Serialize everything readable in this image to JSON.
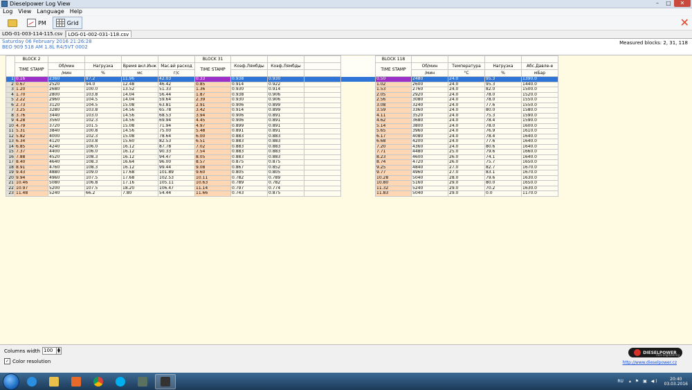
{
  "window": {
    "title": "Dieselpower Log View"
  },
  "menu": [
    "Log",
    "View",
    "Language",
    "Help"
  ],
  "toolbar": {
    "pm_label": "PM",
    "grid_label": "Grid"
  },
  "file_tabs": [
    "LOG-01-003-114-115.csv",
    "LOG-01-002-031-118.csv"
  ],
  "info": {
    "date": "Saturday 06 February 2016 21:26:28",
    "vehicle": "BEO 909 518 AM   1.8L R4/5VT       0002",
    "measured_blocks": "Measured blocks: 2, 31, 118"
  },
  "grid": {
    "block_labels": [
      "BLOCK 2",
      "BLOCK 31",
      "BLOCK 118"
    ],
    "time_stamp_label": "TIME STAMP",
    "b2_headers": [
      {
        "name": "Об/мин",
        "unit": "/мин"
      },
      {
        "name": "Нагрузка",
        "unit": "%"
      },
      {
        "name": "Время вкл.Инж",
        "unit": "мс"
      },
      {
        "name": "Мас.вй расход",
        "unit": "г/с"
      }
    ],
    "b31_headers": [
      {
        "name": "Коэф.Лямбды",
        "unit": ""
      },
      {
        "name": "Коэф.Лямбды",
        "unit": ""
      }
    ],
    "b118_headers": [
      {
        "name": "Об/мин",
        "unit": "/мин"
      },
      {
        "name": "Температура",
        "unit": "°C"
      },
      {
        "name": "Нагрузка",
        "unit": "%"
      },
      {
        "name": "Абс.Давле-е",
        "unit": "мБар"
      }
    ],
    "rows": [
      {
        "n": "1",
        "t2": "0.16",
        "b2": [
          "2360",
          "87.2",
          "11.96",
          "42.03"
        ],
        "t31": "0.33",
        "b31": [
          "0.938",
          "0.930"
        ],
        "t118": "0.50",
        "b118": [
          "2480",
          "24.0",
          "95.3",
          "1390.0"
        ]
      },
      {
        "n": "2",
        "t2": "0.67",
        "b2": [
          "2520",
          "94.0",
          "12.48",
          "46.42"
        ],
        "t31": "0.85",
        "b31": [
          "0.914",
          "0.922"
        ],
        "t118": "1.02",
        "b118": [
          "2600",
          "24.0",
          "95.3",
          "1440.0"
        ]
      },
      {
        "n": "3",
        "t2": "1.20",
        "b2": [
          "2680",
          "100.0",
          "13.52",
          "51.33"
        ],
        "t31": "1.36",
        "b31": [
          "0.930",
          "0.914"
        ],
        "t118": "1.53",
        "b118": [
          "2760",
          "24.0",
          "82.0",
          "1500.0"
        ]
      },
      {
        "n": "4",
        "t2": "1.70",
        "b2": [
          "2800",
          "103.8",
          "14.04",
          "56.44"
        ],
        "t31": "1.87",
        "b31": [
          "0.938",
          "0.906"
        ],
        "t118": "2.05",
        "b118": [
          "2920",
          "24.0",
          "78.0",
          "1520.0"
        ]
      },
      {
        "n": "5",
        "t2": "2.22",
        "b2": [
          "2960",
          "104.5",
          "14.04",
          "59.64"
        ],
        "t31": "2.39",
        "b31": [
          "0.930",
          "0.906"
        ],
        "t118": "2.56",
        "b118": [
          "3080",
          "24.0",
          "78.0",
          "1550.0"
        ]
      },
      {
        "n": "6",
        "t2": "2.73",
        "b2": [
          "3120",
          "104.5",
          "15.08",
          "63.81"
        ],
        "t31": "2.91",
        "b31": [
          "0.906",
          "0.899"
        ],
        "t118": "3.08",
        "b118": [
          "3240",
          "24.0",
          "77.6",
          "1550.0"
        ]
      },
      {
        "n": "7",
        "t2": "3.25",
        "b2": [
          "3280",
          "103.8",
          "14.56",
          "65.78"
        ],
        "t31": "3.42",
        "b31": [
          "0.914",
          "0.899"
        ],
        "t118": "3.59",
        "b118": [
          "3360",
          "24.0",
          "80.0",
          "1580.0"
        ]
      },
      {
        "n": "8",
        "t2": "3.76",
        "b2": [
          "3440",
          "103.0",
          "14.56",
          "68.53"
        ],
        "t31": "3.94",
        "b31": [
          "0.906",
          "0.891"
        ],
        "t118": "4.11",
        "b118": [
          "3520",
          "24.0",
          "75.3",
          "1590.0"
        ]
      },
      {
        "n": "9",
        "t2": "4.28",
        "b2": [
          "3560",
          "102.3",
          "14.56",
          "69.94"
        ],
        "t31": "4.45",
        "b31": [
          "0.906",
          "0.891"
        ],
        "t118": "4.62",
        "b118": [
          "3680",
          "24.0",
          "78.4",
          "1590.0"
        ]
      },
      {
        "n": "10",
        "t2": "4.79",
        "b2": [
          "3720",
          "101.5",
          "15.08",
          "71.94"
        ],
        "t31": "4.97",
        "b31": [
          "0.899",
          "0.891"
        ],
        "t118": "5.14",
        "b118": [
          "3800",
          "24.0",
          "78.0",
          "1600.0"
        ]
      },
      {
        "n": "11",
        "t2": "5.31",
        "b2": [
          "3840",
          "100.8",
          "14.56",
          "75.00"
        ],
        "t31": "5.48",
        "b31": [
          "0.891",
          "0.891"
        ],
        "t118": "5.65",
        "b118": [
          "3960",
          "24.0",
          "76.9",
          "1610.0"
        ]
      },
      {
        "n": "12",
        "t2": "5.82",
        "b2": [
          "4000",
          "102.3",
          "15.08",
          "78.64"
        ],
        "t31": "6.00",
        "b31": [
          "0.883",
          "0.883"
        ],
        "t118": "6.17",
        "b118": [
          "4080",
          "24.0",
          "78.4",
          "1640.0"
        ]
      },
      {
        "n": "13",
        "t2": "6.34",
        "b2": [
          "4120",
          "103.8",
          "15.60",
          "82.53"
        ],
        "t31": "6.51",
        "b31": [
          "0.883",
          "0.883"
        ],
        "t118": "6.68",
        "b118": [
          "4200",
          "24.0",
          "77.6",
          "1640.0"
        ]
      },
      {
        "n": "14",
        "t2": "6.85",
        "b2": [
          "4240",
          "106.0",
          "16.12",
          "87.78"
        ],
        "t31": "7.02",
        "b31": [
          "0.883",
          "0.883"
        ],
        "t118": "7.20",
        "b118": [
          "4360",
          "24.0",
          "80.6",
          "1640.0"
        ]
      },
      {
        "n": "15",
        "t2": "7.37",
        "b2": [
          "4400",
          "106.0",
          "16.12",
          "90.33"
        ],
        "t31": "7.54",
        "b31": [
          "0.883",
          "0.883"
        ],
        "t118": "7.71",
        "b118": [
          "4480",
          "25.0",
          "79.6",
          "1660.0"
        ]
      },
      {
        "n": "16",
        "t2": "7.88",
        "b2": [
          "4520",
          "108.3",
          "16.12",
          "94.47"
        ],
        "t31": "8.05",
        "b31": [
          "0.883",
          "0.883"
        ],
        "t118": "8.23",
        "b118": [
          "4600",
          "26.0",
          "74.1",
          "1640.0"
        ]
      },
      {
        "n": "17",
        "t2": "8.40",
        "b2": [
          "4640",
          "108.3",
          "16.64",
          "96.00"
        ],
        "t31": "8.57",
        "b31": [
          "0.875",
          "0.875"
        ],
        "t118": "8.74",
        "b118": [
          "4720",
          "26.0",
          "75.7",
          "1650.0"
        ]
      },
      {
        "n": "18",
        "t2": "8.91",
        "b2": [
          "4760",
          "108.3",
          "16.12",
          "99.44"
        ],
        "t31": "9.08",
        "b31": [
          "0.867",
          "0.852"
        ],
        "t118": "9.25",
        "b118": [
          "4840",
          "27.0",
          "82.7",
          "1670.0"
        ]
      },
      {
        "n": "19",
        "t2": "9.43",
        "b2": [
          "4880",
          "109.0",
          "17.68",
          "101.89"
        ],
        "t31": "9.60",
        "b31": [
          "0.805",
          "0.805"
        ],
        "t118": "9.77",
        "b118": [
          "4960",
          "27.0",
          "83.1",
          "1670.0"
        ]
      },
      {
        "n": "20",
        "t2": "9.94",
        "b2": [
          "4960",
          "107.5",
          "17.68",
          "102.53"
        ],
        "t31": "10.11",
        "b31": [
          "0.782",
          "0.789"
        ],
        "t118": "10.28",
        "b118": [
          "5040",
          "28.0",
          "79.6",
          "1630.0"
        ]
      },
      {
        "n": "21",
        "t2": "10.46",
        "b2": [
          "5080",
          "106.8",
          "17.16",
          "105.11"
        ],
        "t31": "10.63",
        "b31": [
          "0.789",
          "0.782"
        ],
        "t118": "10.80",
        "b118": [
          "5160",
          "29.0",
          "80.0",
          "1650.0"
        ]
      },
      {
        "n": "22",
        "t2": "10.97",
        "b2": [
          "5200",
          "107.5",
          "18.20",
          "106.47"
        ],
        "t31": "11.14",
        "b31": [
          "0.797",
          "0.774"
        ],
        "t118": "11.32",
        "b118": [
          "5240",
          "29.0",
          "70.2",
          "1630.0"
        ]
      },
      {
        "n": "23",
        "t2": "11.48",
        "b2": [
          "5240",
          "66.2",
          "7.80",
          "54.44"
        ],
        "t31": "11.66",
        "b31": [
          "0.743",
          "0.875"
        ],
        "t118": "11.83",
        "b118": [
          "5040",
          "29.0",
          "0.0",
          "1170.0"
        ]
      }
    ]
  },
  "bottom": {
    "columns_width_label": "Columns width",
    "columns_width_value": "100",
    "color_resolution_label": "Color resolution",
    "logo_text": "DIESELPOWER",
    "logo_sub": "race engineering",
    "site_link": "http://www.dieselpower.cz"
  },
  "taskbar": {
    "lang": "RU",
    "time": "20:40",
    "date": "03.03.2016"
  }
}
